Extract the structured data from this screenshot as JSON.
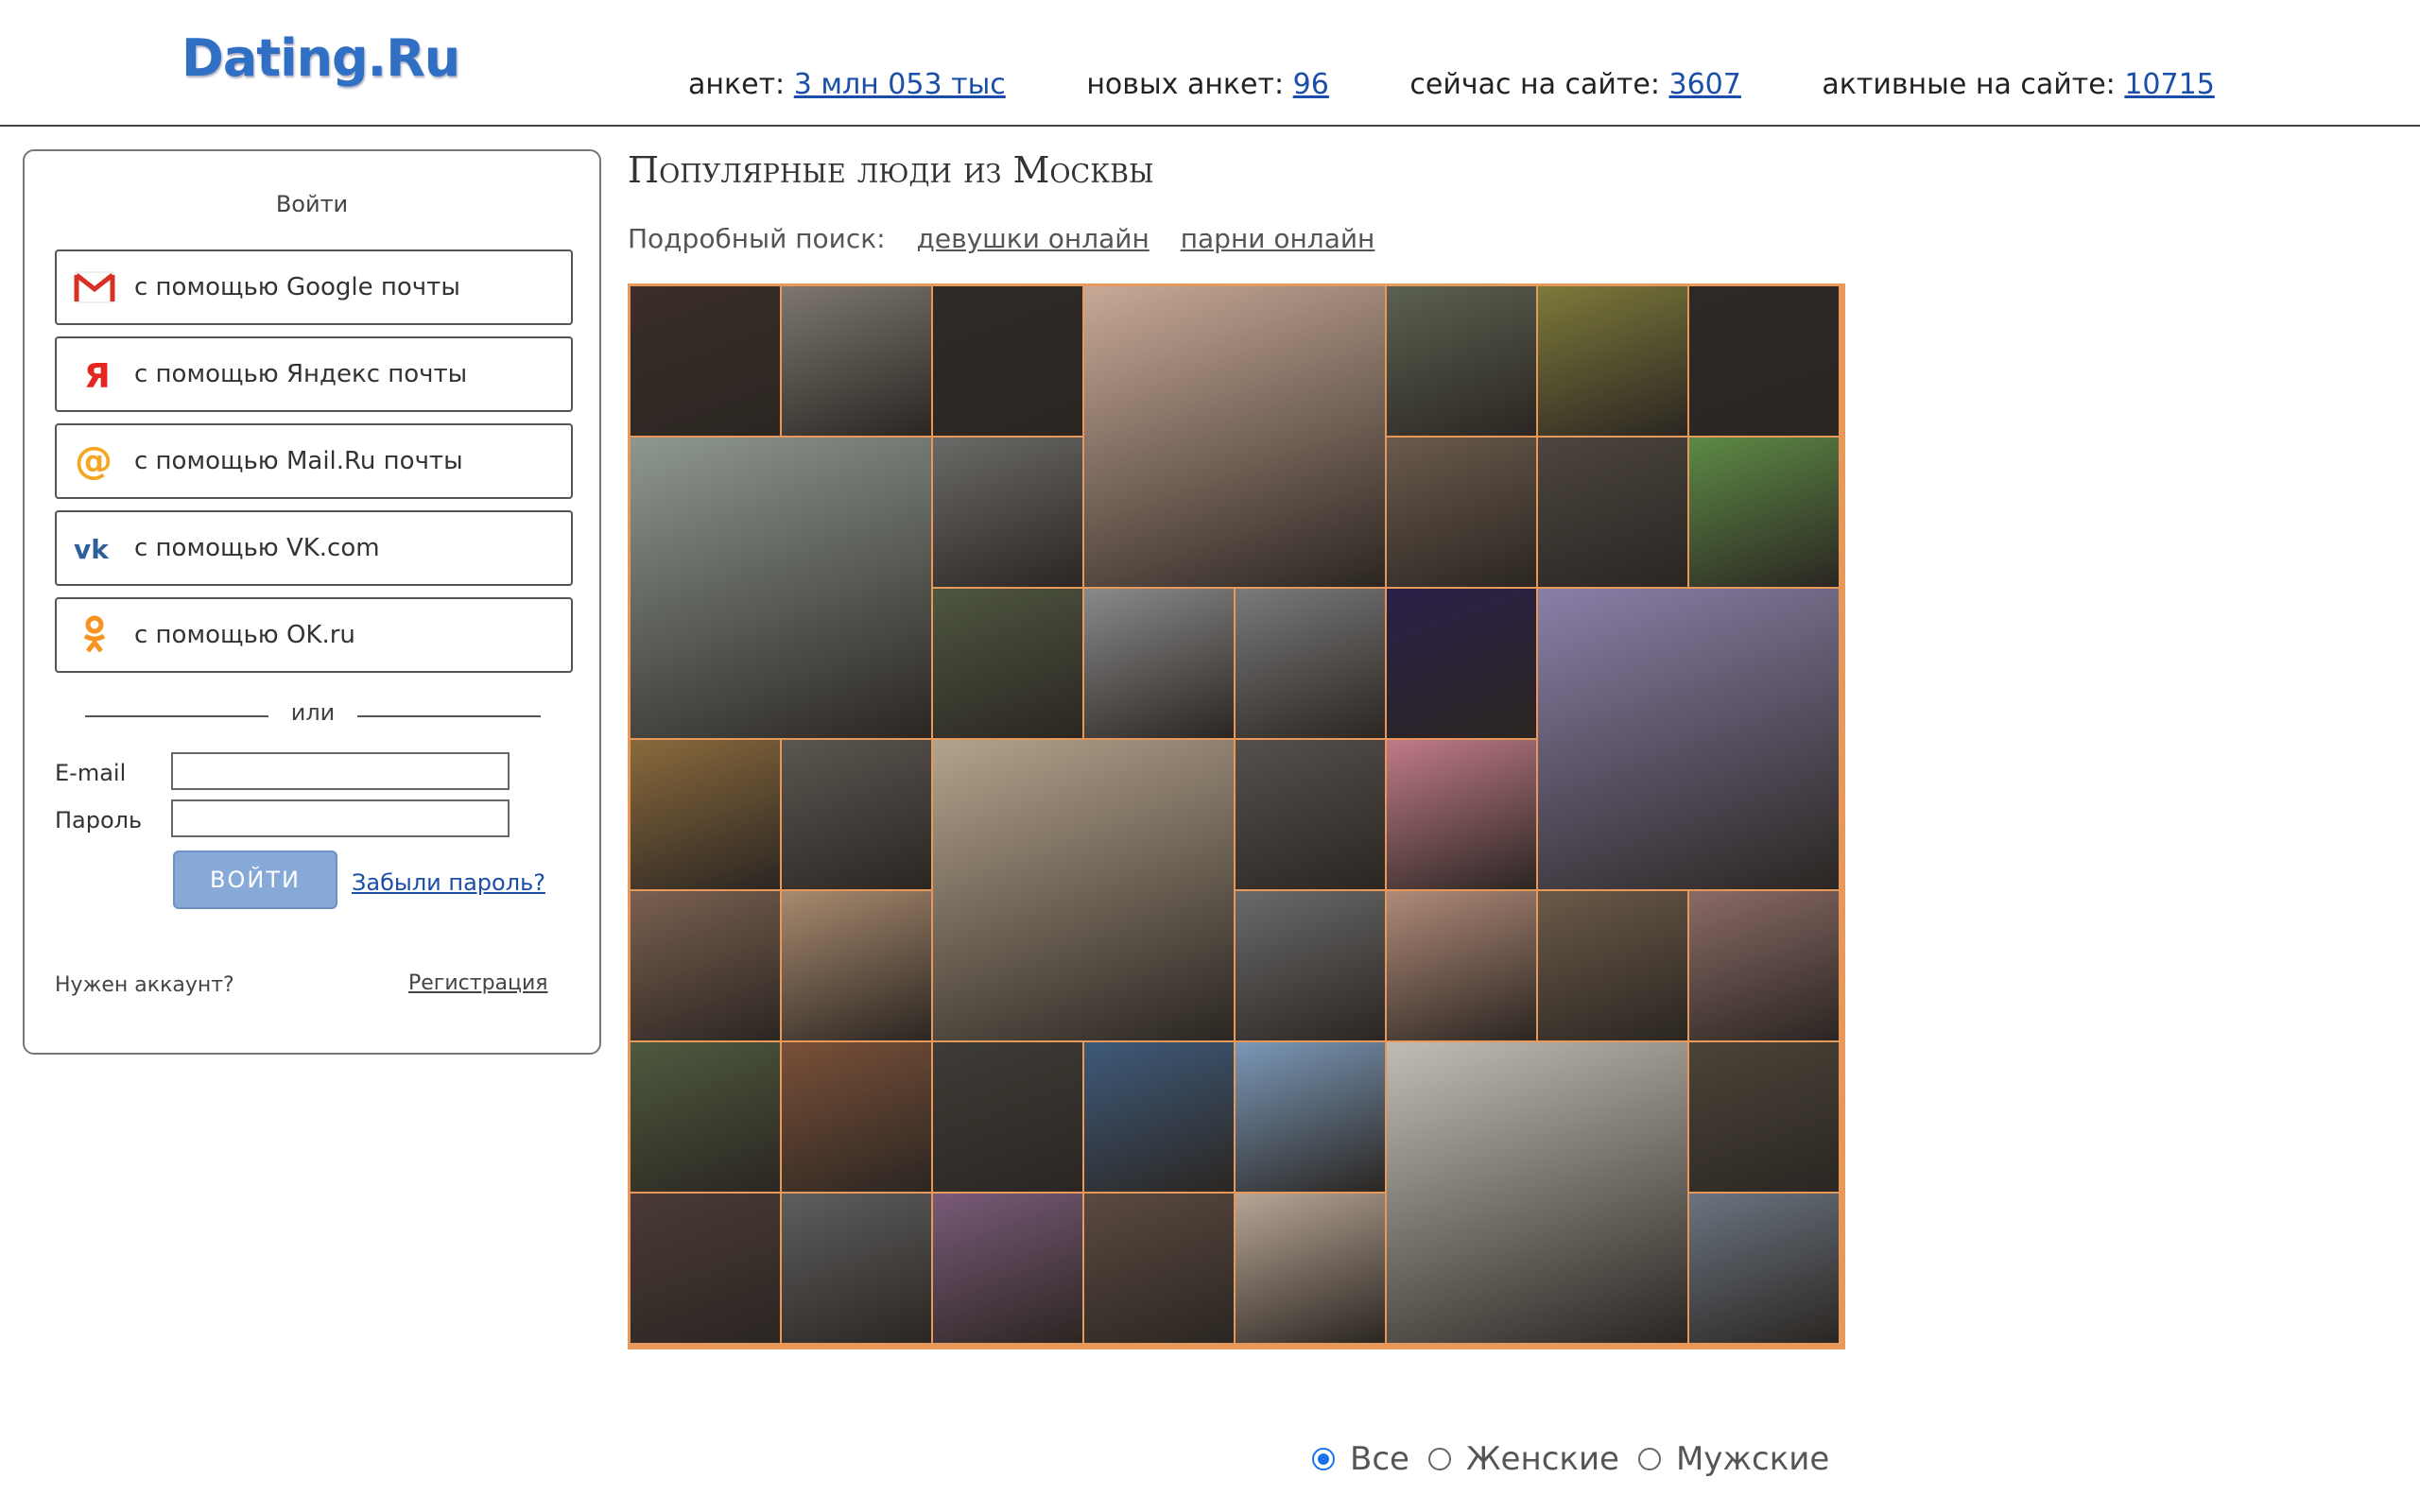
{
  "header": {
    "logo": "Dating.Ru",
    "stats": [
      {
        "label": "анкет:",
        "value": "3 млн 053 тыс"
      },
      {
        "label": "новых анкет:",
        "value": "96"
      },
      {
        "label": "сейчас на сайте:",
        "value": "3607"
      },
      {
        "label": "активные на сайте:",
        "value": "10715"
      }
    ]
  },
  "login": {
    "title": "Войти",
    "providers": [
      {
        "label": "с помощью Google почты",
        "icon": "gmail-icon"
      },
      {
        "label": "с помощью Яндекс почты",
        "icon": "yandex-icon"
      },
      {
        "label": "с помощью Mail.Ru почты",
        "icon": "mailru-icon"
      },
      {
        "label": "с помощью VK.com",
        "icon": "vk-icon"
      },
      {
        "label": "с помощью OK.ru",
        "icon": "ok-icon"
      }
    ],
    "separator": "или",
    "email_label": "E-mail",
    "password_label": "Пароль",
    "email_value": "",
    "password_value": "",
    "submit": "ВОЙТИ",
    "forgot": "Забыли пароль?",
    "need_account": "Нужен аккаунт?",
    "register": "Регистрация"
  },
  "main": {
    "heading": "Популярные люди из Москвы",
    "search_label": "Подробный поиск:",
    "search_links": [
      "девушки онлайн",
      "парни онлайн"
    ],
    "photos": [
      {
        "col": 1,
        "row": 1,
        "cs": 1,
        "rs": 1,
        "color": "#3a2e28"
      },
      {
        "col": 2,
        "row": 1,
        "cs": 1,
        "rs": 1,
        "color": "#7d7770"
      },
      {
        "col": 3,
        "row": 1,
        "cs": 1,
        "rs": 1,
        "color": "#2e2a26"
      },
      {
        "col": 4,
        "row": 1,
        "cs": 2,
        "rs": 2,
        "color": "#c8a996"
      },
      {
        "col": 6,
        "row": 1,
        "cs": 1,
        "rs": 1,
        "color": "#5b6150"
      },
      {
        "col": 7,
        "row": 1,
        "cs": 1,
        "rs": 1,
        "color": "#7d7a3a"
      },
      {
        "col": 8,
        "row": 1,
        "cs": 1,
        "rs": 1,
        "color": "#2e2826"
      },
      {
        "col": 1,
        "row": 2,
        "cs": 2,
        "rs": 2,
        "color": "#8e9890"
      },
      {
        "col": 3,
        "row": 2,
        "cs": 1,
        "rs": 1,
        "color": "#6b6a68"
      },
      {
        "col": 6,
        "row": 2,
        "cs": 1,
        "rs": 1,
        "color": "#6a5a4c"
      },
      {
        "col": 7,
        "row": 2,
        "cs": 1,
        "rs": 1,
        "color": "#4c4540"
      },
      {
        "col": 8,
        "row": 2,
        "cs": 1,
        "rs": 1,
        "color": "#5d8a45"
      },
      {
        "col": 3,
        "row": 3,
        "cs": 1,
        "rs": 1,
        "color": "#4e5640"
      },
      {
        "col": 4,
        "row": 3,
        "cs": 1,
        "rs": 1,
        "color": "#8a8a8a"
      },
      {
        "col": 5,
        "row": 3,
        "cs": 1,
        "rs": 1,
        "color": "#7a7a7a"
      },
      {
        "col": 6,
        "row": 3,
        "cs": 1,
        "rs": 1,
        "color": "#2a2048"
      },
      {
        "col": 7,
        "row": 3,
        "cs": 2,
        "rs": 2,
        "color": "#8a7fa8"
      },
      {
        "col": 1,
        "row": 4,
        "cs": 1,
        "rs": 1,
        "color": "#8a6a3c"
      },
      {
        "col": 2,
        "row": 4,
        "cs": 1,
        "rs": 1,
        "color": "#5a5650"
      },
      {
        "col": 3,
        "row": 4,
        "cs": 2,
        "rs": 2,
        "color": "#b4a38c"
      },
      {
        "col": 5,
        "row": 4,
        "cs": 1,
        "rs": 1,
        "color": "#55504e"
      },
      {
        "col": 6,
        "row": 4,
        "cs": 1,
        "rs": 1,
        "color": "#c07a88"
      },
      {
        "col": 1,
        "row": 5,
        "cs": 1,
        "rs": 1,
        "color": "#7a6050"
      },
      {
        "col": 2,
        "row": 5,
        "cs": 1,
        "rs": 1,
        "color": "#a88a6e"
      },
      {
        "col": 5,
        "row": 5,
        "cs": 1,
        "rs": 1,
        "color": "#6a6a6a"
      },
      {
        "col": 6,
        "row": 5,
        "cs": 1,
        "rs": 1,
        "color": "#b08a78"
      },
      {
        "col": 7,
        "row": 5,
        "cs": 1,
        "rs": 1,
        "color": "#6a5a48"
      },
      {
        "col": 8,
        "row": 5,
        "cs": 1,
        "rs": 1,
        "color": "#8a6a66"
      },
      {
        "col": 1,
        "row": 6,
        "cs": 1,
        "rs": 1,
        "color": "#4e5a3e"
      },
      {
        "col": 2,
        "row": 6,
        "cs": 1,
        "rs": 1,
        "color": "#7a5038"
      },
      {
        "col": 3,
        "row": 6,
        "cs": 1,
        "rs": 1,
        "color": "#3e3c36"
      },
      {
        "col": 4,
        "row": 6,
        "cs": 1,
        "rs": 1,
        "color": "#3e5a7a"
      },
      {
        "col": 5,
        "row": 6,
        "cs": 1,
        "rs": 1,
        "color": "#7a98b8"
      },
      {
        "col": 6,
        "row": 6,
        "cs": 2,
        "rs": 2,
        "color": "#c2bdb4"
      },
      {
        "col": 8,
        "row": 6,
        "cs": 1,
        "rs": 1,
        "color": "#4a4438"
      },
      {
        "col": 1,
        "row": 7,
        "cs": 1,
        "rs": 1,
        "color": "#4a3a36"
      },
      {
        "col": 2,
        "row": 7,
        "cs": 1,
        "rs": 1,
        "color": "#5e5e5e"
      },
      {
        "col": 3,
        "row": 7,
        "cs": 1,
        "rs": 1,
        "color": "#7a5a78"
      },
      {
        "col": 4,
        "row": 7,
        "cs": 1,
        "rs": 1,
        "color": "#5a4a40"
      },
      {
        "col": 5,
        "row": 7,
        "cs": 1,
        "rs": 1,
        "color": "#b8a696"
      },
      {
        "col": 8,
        "row": 7,
        "cs": 1,
        "rs": 1,
        "color": "#6a7480"
      }
    ]
  },
  "filters": {
    "options": [
      "Все",
      "Женские",
      "Мужские"
    ],
    "selected": "Все"
  }
}
